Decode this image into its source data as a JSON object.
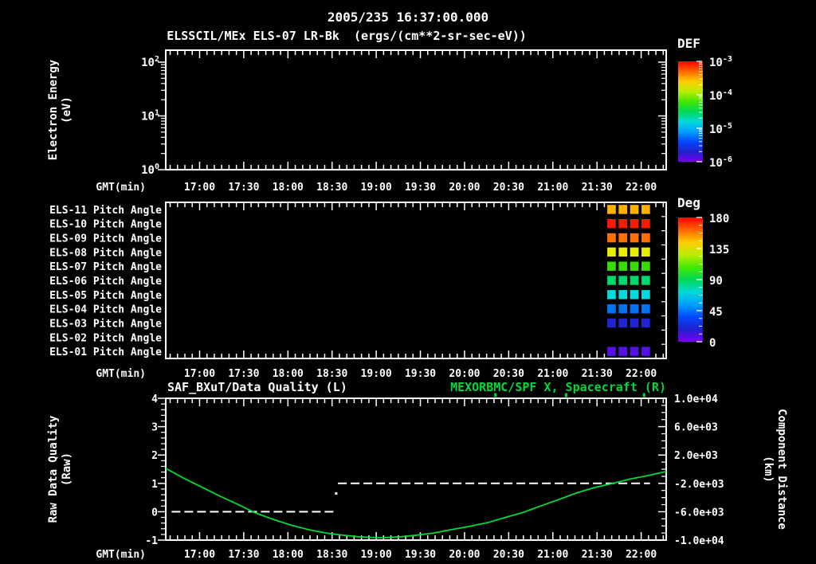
{
  "header": {
    "title": "2005/235 16:37:00.000",
    "subtitle": "ELSSCIL/MEx ELS-07 LR-Bk  (ergs/(cm**2-sr-sec-eV))"
  },
  "colors": {
    "background": "#000000",
    "foreground": "#ffffff",
    "accent_green": "#00d83c",
    "rainbow_top_to_bottom": [
      "#ff0000",
      "#ff6600",
      "#ffcc00",
      "#bbee00",
      "#44e800",
      "#00d855",
      "#00d8d8",
      "#00a0ff",
      "#0048ff",
      "#2020cc",
      "#7a00f0"
    ]
  },
  "time_axis": {
    "label": "GMT(min)",
    "start_gmt": "16:37",
    "end_gmt": "22:17",
    "span_min": 340,
    "tick_labels": [
      "17:00",
      "17:30",
      "18:00",
      "18:30",
      "19:00",
      "19:30",
      "20:00",
      "20:30",
      "21:00",
      "21:30",
      "22:00"
    ]
  },
  "chart_data": [
    {
      "id": "electron-energy-spectrogram",
      "type": "heatmap",
      "title": "ELSSCIL/MEx ELS-07 LR-Bk",
      "units": "(ergs/(cm**2-sr-sec-eV))",
      "ylabel_lines": [
        "Electron Energy",
        "(eV)"
      ],
      "yscale": "log",
      "ytick_labels": [
        {
          "base": "10",
          "exp": "2"
        },
        {
          "base": "10",
          "exp": "1"
        },
        {
          "base": "10",
          "exp": "0"
        }
      ],
      "values": [],
      "note": "no spectrogram data plotted (panel empty/black)",
      "colorbar": {
        "label": "DEF",
        "scale": "log",
        "tick_labels": [
          {
            "base": "10",
            "exp": "-3"
          },
          {
            "base": "10",
            "exp": "-4"
          },
          {
            "base": "10",
            "exp": "-5"
          },
          {
            "base": "10",
            "exp": "-6"
          }
        ]
      }
    },
    {
      "id": "pitch-angle-panel",
      "type": "heatmap",
      "rows": [
        {
          "label": "ELS-11 Pitch Angle",
          "value_deg": 152,
          "color": "#ffb000"
        },
        {
          "label": "ELS-10 Pitch Angle",
          "value_deg": 178,
          "color": "#ff1800"
        },
        {
          "label": "ELS-09 Pitch Angle",
          "value_deg": 163,
          "color": "#ff7000"
        },
        {
          "label": "ELS-08 Pitch Angle",
          "value_deg": 140,
          "color": "#e8ee00"
        },
        {
          "label": "ELS-07 Pitch Angle",
          "value_deg": 113,
          "color": "#38dc00"
        },
        {
          "label": "ELS-06 Pitch Angle",
          "value_deg": 95,
          "color": "#00dc6c"
        },
        {
          "label": "ELS-05 Pitch Angle",
          "value_deg": 79,
          "color": "#00dcdc"
        },
        {
          "label": "ELS-04 Pitch Angle",
          "value_deg": 57,
          "color": "#0074f0"
        },
        {
          "label": "ELS-03 Pitch Angle",
          "value_deg": 42,
          "color": "#2024d4"
        },
        {
          "label": "ELS-02 Pitch Angle",
          "value_deg": null,
          "color": null
        },
        {
          "label": "ELS-01 Pitch Angle",
          "value_deg": 8,
          "color": "#5810e8"
        }
      ],
      "block": {
        "t_start_min": 299,
        "t_end_min": 330,
        "columns": 4
      },
      "colorbar": {
        "label": "Deg",
        "scale": "linear",
        "range": [
          0,
          180
        ],
        "tick_labels": [
          "180",
          "135",
          "90",
          "45",
          "0"
        ]
      }
    },
    {
      "id": "quality-distance-panel",
      "type": "line",
      "title_left": "SAF_BXuT/Data Quality (L)",
      "title_right": "MEXORBMC/SPF X, Spacecraft (R)",
      "ylabel_left_lines": [
        "Raw Data Quality",
        "(Raw)"
      ],
      "ylabel_right_lines": [
        "Component Distance",
        "(km)"
      ],
      "ylim_left": [
        -1,
        4
      ],
      "ytick_labels_left": [
        "4",
        "3",
        "2",
        "1",
        "0",
        "-1"
      ],
      "ylim_right": [
        -10000,
        10000
      ],
      "ytick_labels_right": [
        "1.0e+04",
        "6.0e+03",
        "2.0e+03",
        "-2.0e+03",
        "-6.0e+03",
        "-1.0e+04"
      ],
      "series": [
        {
          "name": "SAF_BXuT Data Quality",
          "axis": "left",
          "style": "dashed",
          "color": "#ffffff",
          "segments": [
            {
              "t_start_min": 4,
              "t_end_min": 115,
              "value": 0
            },
            {
              "t_start_min": 117,
              "t_end_min": 329,
              "value": 1
            }
          ],
          "transition_dot": {
            "t_min": 115.5,
            "value": 0.66
          }
        },
        {
          "name": "MEXORBMC/SPF X Spacecraft",
          "axis": "right",
          "style": "solid",
          "color": "#00d83c",
          "points_t_min": [
            0,
            12,
            24,
            36,
            49,
            60,
            73,
            85,
            97,
            109,
            121,
            133,
            146,
            158,
            170,
            182,
            194,
            206,
            219,
            230,
            243,
            255,
            267,
            279,
            291,
            303,
            316,
            328,
            340
          ],
          "points_km": [
            120,
            -1240,
            -2480,
            -3720,
            -4960,
            -6080,
            -7080,
            -7880,
            -8520,
            -9000,
            -9320,
            -9560,
            -9680,
            -9560,
            -9320,
            -9000,
            -8520,
            -8080,
            -7520,
            -6840,
            -6080,
            -5160,
            -4280,
            -3360,
            -2600,
            -2040,
            -1360,
            -880,
            -320
          ]
        }
      ],
      "top_edge_marks_t_min": [
        224,
        272,
        325
      ]
    }
  ]
}
